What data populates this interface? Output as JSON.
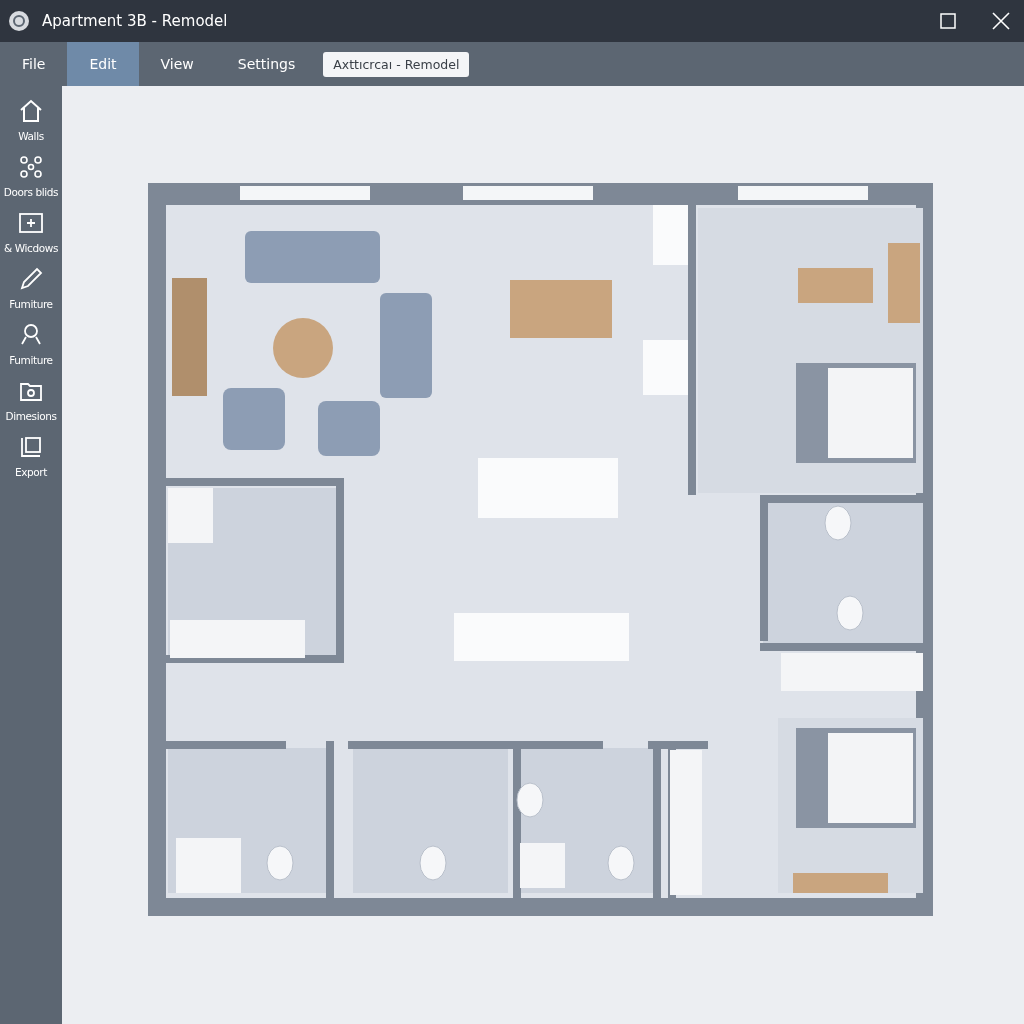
{
  "window": {
    "title": "Apartment 3B - Remodel"
  },
  "menu": [
    {
      "label": "File",
      "selected": false
    },
    {
      "label": "Edit",
      "selected": true
    },
    {
      "label": "View",
      "selected": false
    },
    {
      "label": "Settings",
      "selected": false
    }
  ],
  "document_tab": {
    "label": "Axttıcrcaı - Remodel"
  },
  "sidebar": {
    "items": [
      {
        "label": "Walls"
      },
      {
        "label": "Doors blids"
      },
      {
        "label": "& Wicdows"
      },
      {
        "label": "Fumiture"
      },
      {
        "label": "Fumiture"
      },
      {
        "label": "Dimesions"
      },
      {
        "label": "Export"
      }
    ]
  }
}
